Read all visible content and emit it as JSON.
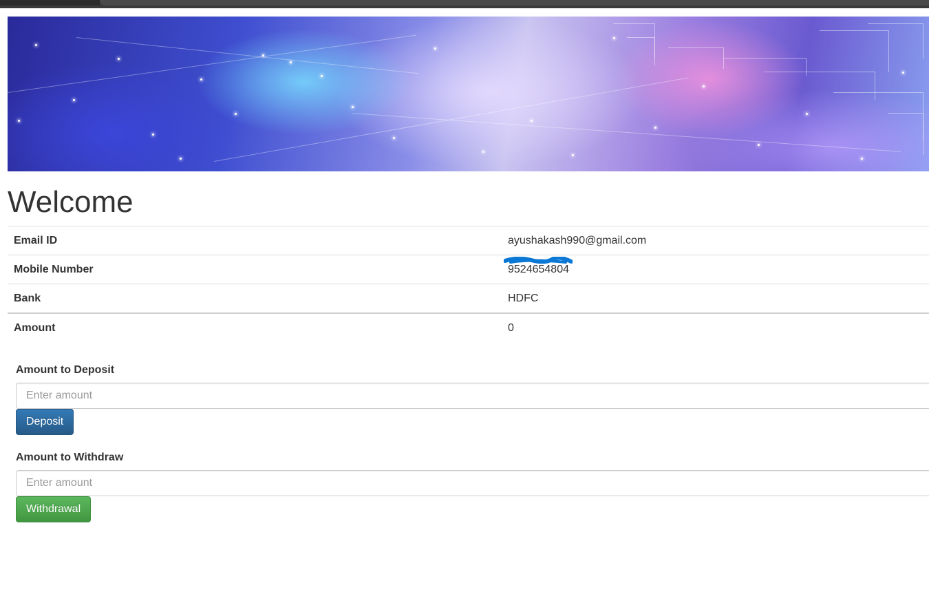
{
  "page": {
    "heading": "Welcome"
  },
  "account": {
    "rows": [
      {
        "label": "Email ID",
        "value": "ayushakash990@gmail.com"
      },
      {
        "label": "Mobile Number",
        "value": "9524654804"
      },
      {
        "label": "Bank",
        "value": "HDFC"
      },
      {
        "label": "Amount",
        "value": "0"
      }
    ]
  },
  "deposit": {
    "label": "Amount to Deposit",
    "placeholder": "Enter amount",
    "button_label": "Deposit"
  },
  "withdraw": {
    "label": "Amount to Withdraw",
    "placeholder": "Enter amount",
    "button_label": "Withdrawal"
  },
  "colors": {
    "primary_button": "#337ab7",
    "success_button": "#5cb85c",
    "redaction_mark": "#0a78d4"
  },
  "icons": {
    "banner": "space-circuit-banner-image"
  }
}
